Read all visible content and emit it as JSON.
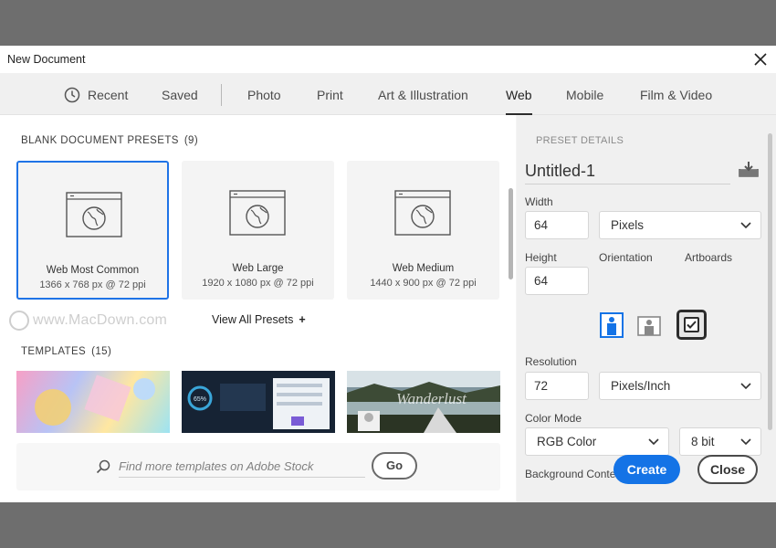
{
  "dialog": {
    "title": "New Document"
  },
  "tabs": [
    {
      "label": "Recent"
    },
    {
      "label": "Saved"
    },
    {
      "label": "Photo"
    },
    {
      "label": "Print"
    },
    {
      "label": "Art & Illustration"
    },
    {
      "label": "Web",
      "active": true
    },
    {
      "label": "Mobile"
    },
    {
      "label": "Film & Video"
    }
  ],
  "blank_presets": {
    "title": "BLANK DOCUMENT PRESETS",
    "count": "(9)",
    "items": [
      {
        "name": "Web Most Common",
        "dims": "1366 x 768 px @ 72 ppi",
        "selected": true
      },
      {
        "name": "Web Large",
        "dims": "1920 x 1080 px @ 72 ppi"
      },
      {
        "name": "Web Medium",
        "dims": "1440 x 900 px @ 72 ppi"
      }
    ],
    "view_all": "View All Presets",
    "view_all_icon": "+"
  },
  "watermark": {
    "text": "www.MacDown.com"
  },
  "templates": {
    "title": "TEMPLATES",
    "count": "(15)",
    "items": [
      {
        "thumb_text": ""
      },
      {
        "thumb_text": "65%"
      },
      {
        "thumb_text": "Wanderlust"
      }
    ]
  },
  "stock_search": {
    "placeholder": "Find more templates on Adobe Stock",
    "go_label": "Go"
  },
  "preset_details": {
    "title": "PRESET DETAILS",
    "document_name": "Untitled-1",
    "width_label": "Width",
    "width_value": "64",
    "width_unit": "Pixels",
    "height_label": "Height",
    "height_value": "64",
    "orientation_label": "Orientation",
    "artboards_label": "Artboards",
    "artboards_checked": true,
    "resolution_label": "Resolution",
    "resolution_value": "72",
    "resolution_unit": "Pixels/Inch",
    "color_mode_label": "Color Mode",
    "color_mode_value": "RGB Color",
    "bit_depth": "8 bit",
    "background_label": "Background Contents"
  },
  "actions": {
    "create_label": "Create",
    "close_label": "Close"
  },
  "colors": {
    "accent": "#1473e6",
    "selected_border": "#1f73e6"
  }
}
